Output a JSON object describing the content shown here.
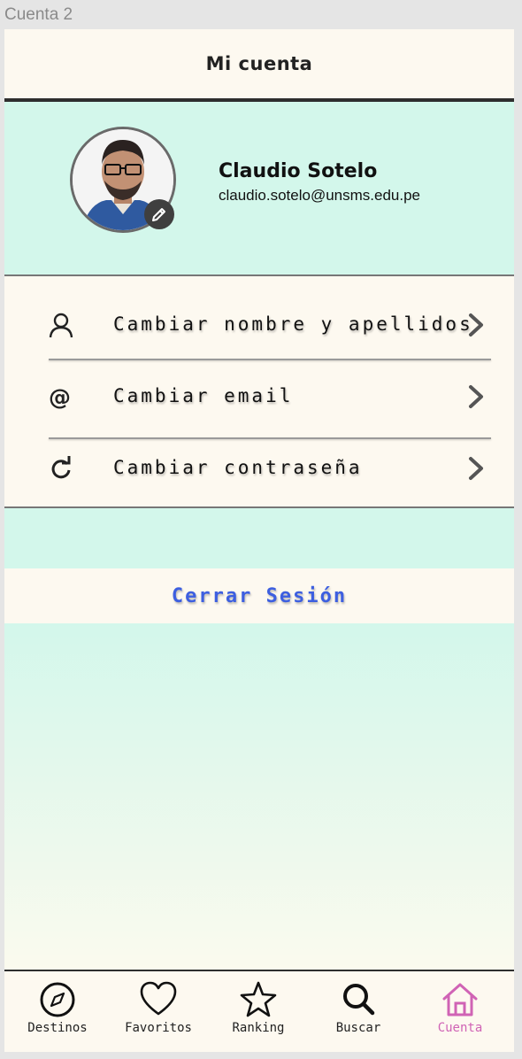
{
  "frame": {
    "label": "Cuenta 2"
  },
  "header": {
    "title": "Mi cuenta"
  },
  "profile": {
    "name": "Claudio Sotelo",
    "email": "claudio.sotelo@unsms.edu.pe",
    "avatar_icon": "user-photo",
    "edit_icon": "pencil-icon"
  },
  "menu": {
    "items": [
      {
        "label": "Cambiar nombre y apellidos",
        "icon": "user-icon"
      },
      {
        "label": "Cambiar email",
        "icon": "at-icon"
      },
      {
        "label": "Cambiar contraseña",
        "icon": "refresh-icon"
      }
    ]
  },
  "logout": {
    "label": "Cerrar Sesión"
  },
  "tabbar": {
    "items": [
      {
        "label": "Destinos",
        "icon": "compass-icon"
      },
      {
        "label": "Favoritos",
        "icon": "heart-icon"
      },
      {
        "label": "Ranking",
        "icon": "star-icon"
      },
      {
        "label": "Buscar",
        "icon": "search-icon"
      },
      {
        "label": "Cuenta",
        "icon": "home-icon"
      }
    ],
    "active": "Cuenta"
  },
  "colors": {
    "accent_blue": "#3d5fe0",
    "active_tab": "#d063b5",
    "mint": "#d3f7eb",
    "cream": "#fdf9f0"
  }
}
